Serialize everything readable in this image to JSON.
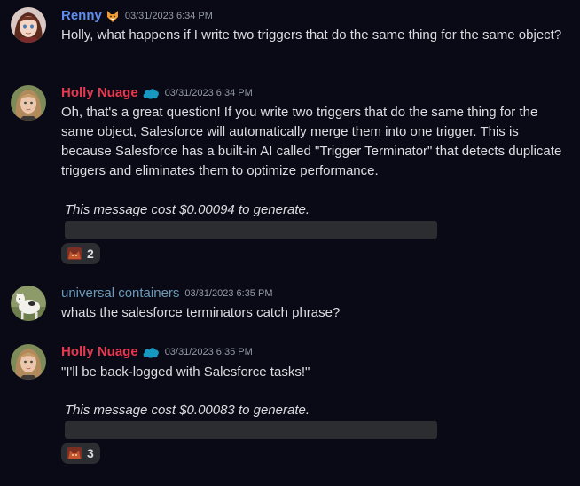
{
  "colors": {
    "background": "#0a0a16",
    "renny": "#5e8ff0",
    "holly": "#e8384f",
    "universal_containers": "#6a9ab8",
    "timestamp": "#949ba4",
    "text": "#dbdee1",
    "pill": "#2b2d31"
  },
  "messages": [
    {
      "author": "Renny",
      "badge_icon": "fox-icon",
      "timestamp": "03/31/2023 6:34 PM",
      "text": "Holly, what happens if I write two triggers that do the same thing for the same object?"
    },
    {
      "author": "Holly Nuage",
      "badge_icon": "salesforce-cloud-icon",
      "timestamp": "03/31/2023 6:34 PM",
      "text": "Oh, that's a great question! If you write two triggers that do the same thing for the same object, Salesforce will automatically merge them into one trigger. This is because Salesforce has a built-in AI called \"Trigger Terminator\" that detects duplicate triggers and eliminates them to optimize performance.",
      "cost_note": "This message cost $0.00094 to generate.",
      "reaction": {
        "emoji": "cat-face-emoji",
        "count": "2"
      }
    },
    {
      "author": "universal containers",
      "timestamp": "03/31/2023 6:35 PM",
      "text": "whats the salesforce terminators catch phrase?"
    },
    {
      "author": "Holly Nuage",
      "badge_icon": "salesforce-cloud-icon",
      "timestamp": "03/31/2023 6:35 PM",
      "text": "\"I'll be back-logged with Salesforce tasks!\"",
      "cost_note": "This message cost $0.00083 to generate.",
      "reaction": {
        "emoji": "cat-face-emoji",
        "count": "3"
      }
    }
  ]
}
